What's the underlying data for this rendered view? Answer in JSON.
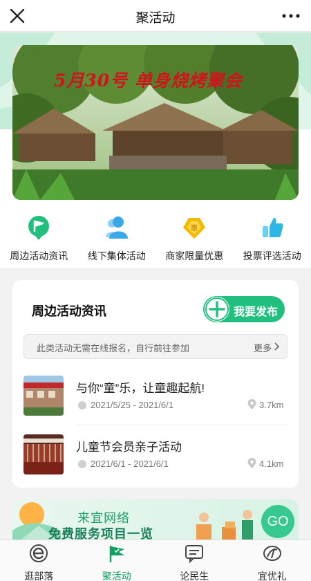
{
  "topbar": {
    "title": "聚活动",
    "close_icon": "close-icon",
    "more_icon": "more-dots-icon"
  },
  "banner": {
    "title": "5月30号 单身烧烤聚会"
  },
  "quick_links": [
    {
      "label": "周边活动资讯",
      "icon": "flag-pin-icon",
      "color": "#22c07e"
    },
    {
      "label": "线下集体活动",
      "icon": "people-icon",
      "color": "#3aa8e8"
    },
    {
      "label": "商家限量优惠",
      "icon": "coupon-icon",
      "color": "#f5b800"
    },
    {
      "label": "投票评选活动",
      "icon": "thumbs-up-icon",
      "color": "#2fb6e6"
    }
  ],
  "news": {
    "title": "周边活动资讯",
    "publish_label": "我要发布",
    "notice": "此类活动无需在线报名，自行前往参加",
    "more_label": "更多",
    "items": [
      {
        "name": "与你“童”乐，让童趣起航!",
        "date": "2021/5/25 - 2021/6/1",
        "distance": "3.7km"
      },
      {
        "name": "儿童节会员亲子活动",
        "date": "2021/6/1 - 2021/6/1",
        "distance": "4.1km"
      }
    ]
  },
  "promo": {
    "line1": "来宜网络",
    "line2": "免费服务项目一览",
    "go_label": "GO"
  },
  "tabbar": [
    {
      "label": "逛部落",
      "icon": "e-logo-icon",
      "active": false
    },
    {
      "label": "聚活动",
      "icon": "flag-icon",
      "active": true
    },
    {
      "label": "论民生",
      "icon": "chat-bubble-icon",
      "active": false
    },
    {
      "label": "宜优礼",
      "icon": "gift-logo-icon",
      "active": false
    }
  ],
  "colors": {
    "accent": "#22c07e",
    "mint_bg": "#dff5ea",
    "banner_title": "#d3131b"
  }
}
